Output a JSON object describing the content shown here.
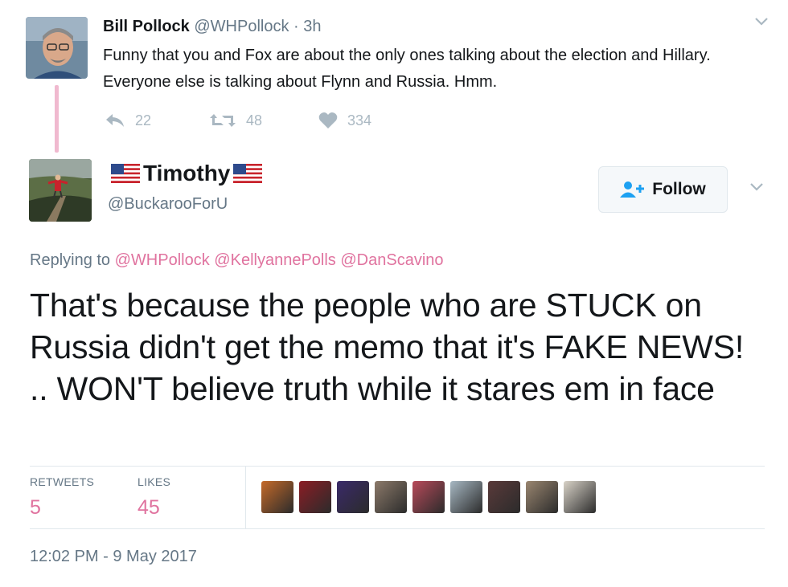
{
  "parent_tweet": {
    "name": "Bill Pollock",
    "handle": "@WHPollock",
    "separator": "·",
    "time": "3h",
    "text": "Funny that you and Fox are about the only ones talking about the election and Hillary. Everyone else is talking about Flynn and Russia. Hmm.",
    "replies": "22",
    "retweets": "48",
    "likes": "334"
  },
  "tweet": {
    "name": "Timothy",
    "handle": "@BuckarooForU",
    "follow_label": "Follow",
    "replying_prefix": "Replying to",
    "mentions": [
      "@WHPollock",
      "@KellyannePolls",
      "@DanScavino"
    ],
    "text": "That's because the people who are STUCK on Russia didn't get the memo that it's FAKE NEWS! .. WON'T believe truth while it stares em in face",
    "retweets_label": "RETWEETS",
    "retweets_count": "5",
    "likes_label": "LIKES",
    "likes_count": "45",
    "timestamp": "12:02 PM - 9 May 2017"
  },
  "colors": {
    "accent": "#e0739f",
    "thread_line": "#f0b9cf",
    "muted": "#657786",
    "icon": "#aab8c2"
  },
  "likers": [
    {
      "icon": "avatar-woman-illustration",
      "color": "#c56a2a"
    },
    {
      "icon": "avatar-make-america-great-again",
      "color": "#8b1d25"
    },
    {
      "icon": "avatar-abstract-dark",
      "color": "#3a2a6a"
    },
    {
      "icon": "avatar-couple-photo",
      "color": "#8c7a6a"
    },
    {
      "icon": "avatar-eagle-flag",
      "color": "#b84a5a"
    },
    {
      "icon": "avatar-person-light",
      "color": "#a7b8c3"
    },
    {
      "icon": "avatar-group-photo",
      "color": "#5a3a3a"
    },
    {
      "icon": "avatar-coffee-cup",
      "color": "#9a8670"
    },
    {
      "icon": "avatar-cat-white",
      "color": "#d9d3c8"
    }
  ]
}
